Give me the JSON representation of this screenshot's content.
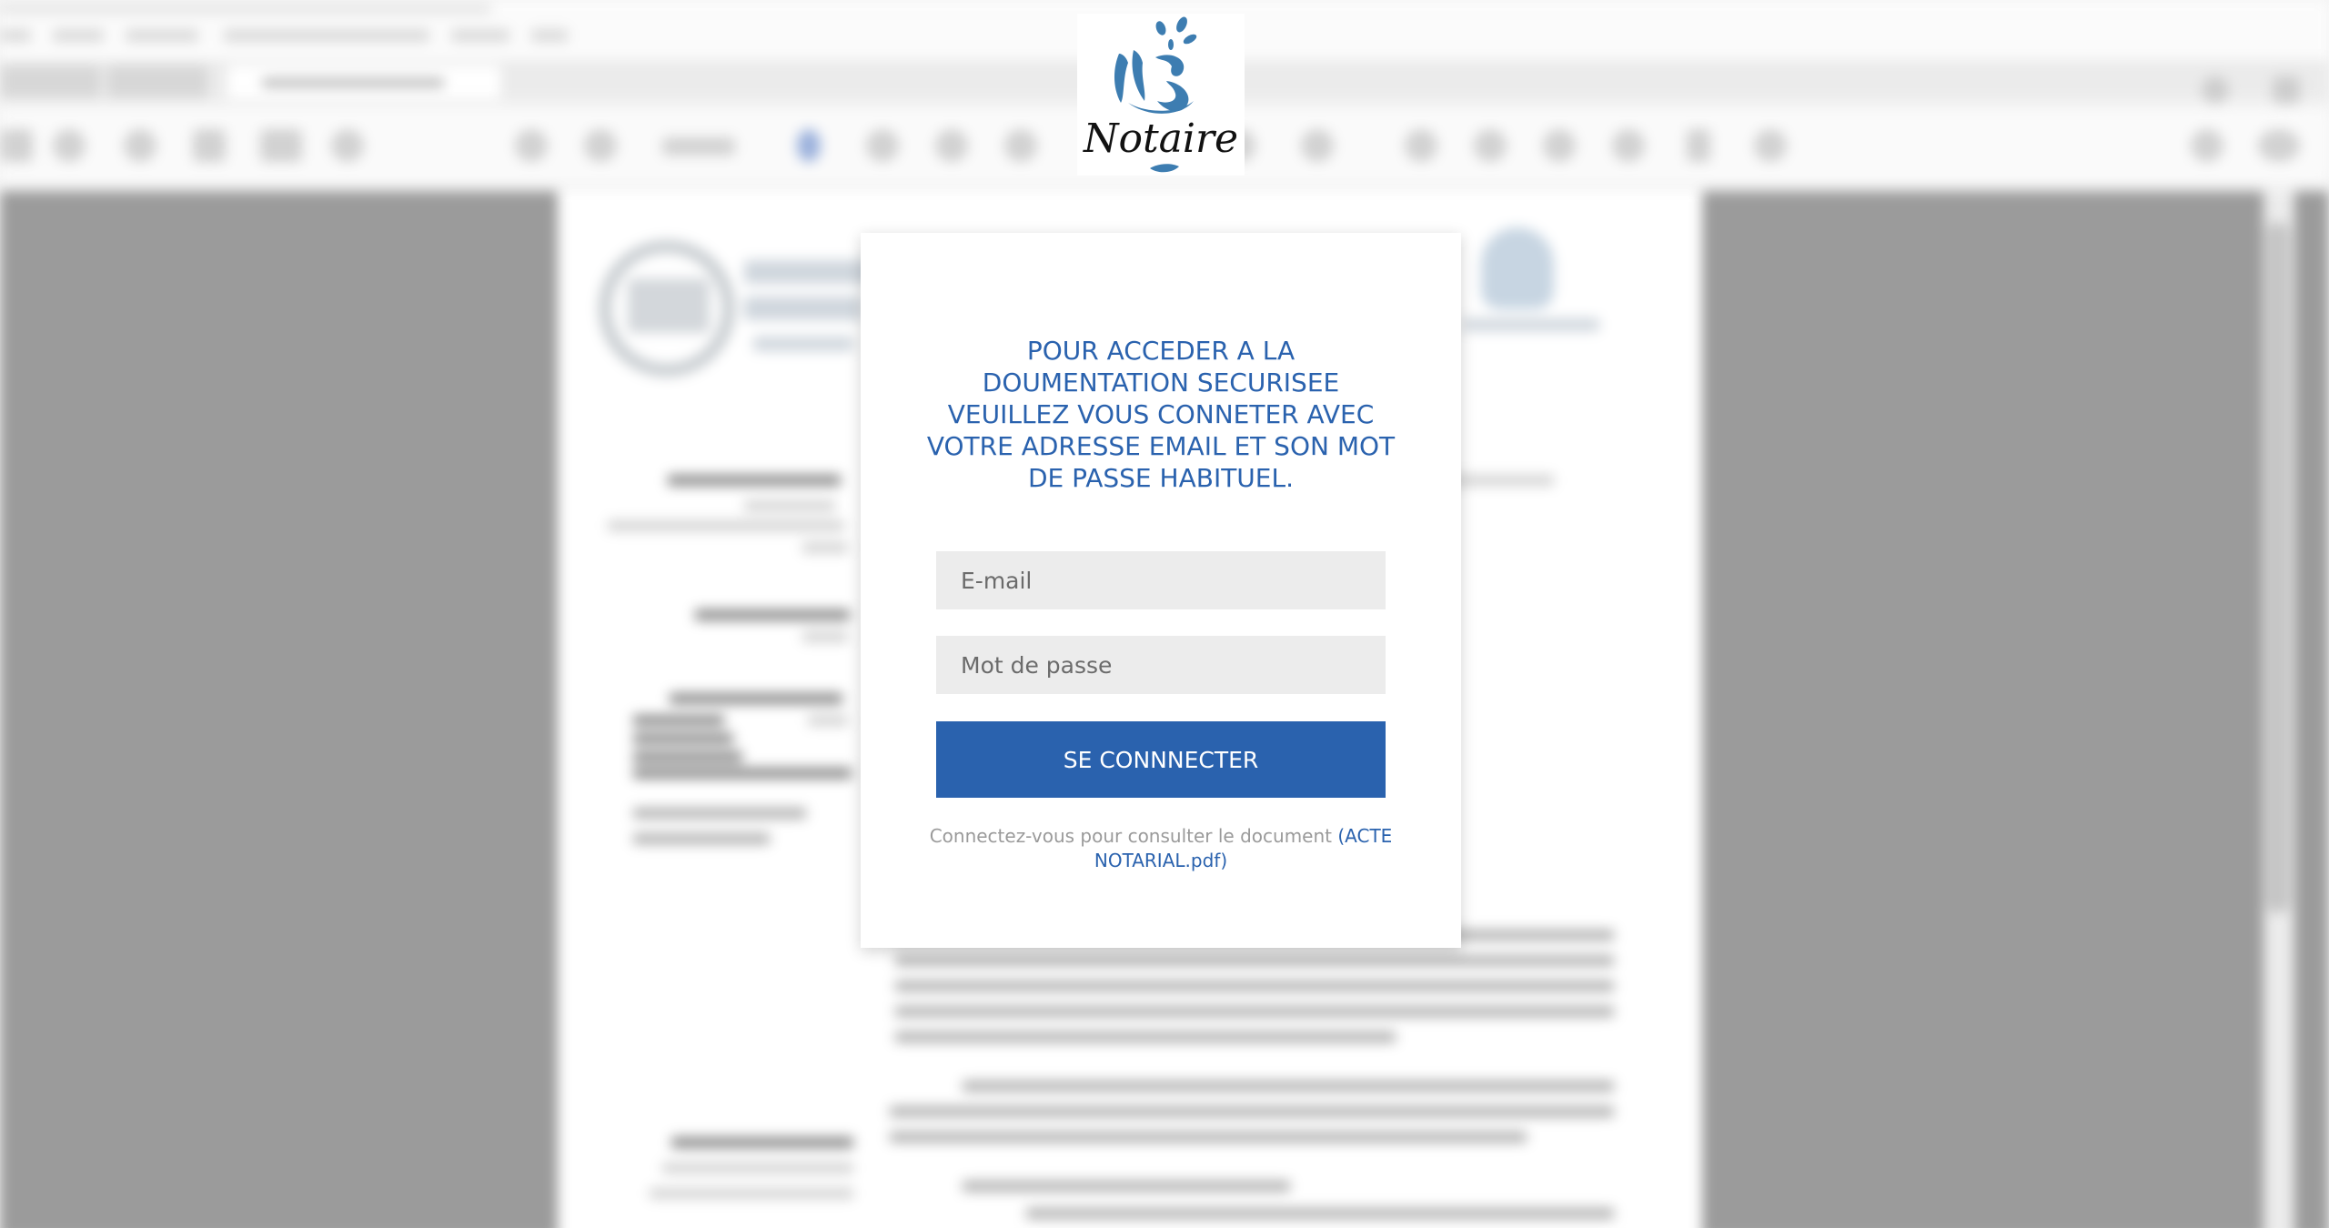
{
  "brand": {
    "logo_text": "Notaire"
  },
  "login": {
    "heading": "POUR ACCEDER A LA DOUMENTATION SECURISEE VEUILLEZ VOUS CONNETER AVEC VOTRE ADRESSE EMAIL ET SON MOT DE PASSE HABITUEL.",
    "email_placeholder": "E-mail",
    "password_placeholder": "Mot de passe",
    "submit_label": "SE CONNNECTER",
    "hint_prefix": "Connectez-vous pour consulter le document",
    "document_link": "(ACTE NOTARIAL.pdf)"
  },
  "colors": {
    "accent": "#2a62ae",
    "logo_blue": "#3d7db1",
    "overlay_gray": "#9b9b9b"
  },
  "icons": [
    "notaire-logo-icon"
  ]
}
